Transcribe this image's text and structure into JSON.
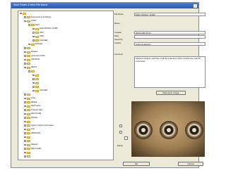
{
  "window": {
    "title": "Save Folder & New File Name"
  },
  "tree": {
    "items": [
      {
        "label": "",
        "depth": 0
      },
      {
        "label": "Documents and Settings",
        "depth": 1
      },
      {
        "label": "Folder",
        "depth": 1
      },
      {
        "label": "0219",
        "depth": 2
      },
      {
        "label": "ELECTRONIC_DUMP",
        "depth": 3
      },
      {
        "label": "0307",
        "depth": 3
      },
      {
        "label": "0329",
        "depth": 3
      },
      {
        "label": "LOGGER",
        "depth": 3
      },
      {
        "label": "Software",
        "depth": 2
      },
      {
        "label": "",
        "depth": 1
      },
      {
        "label": "Melanie",
        "depth": 1
      },
      {
        "label": "parameter Folder",
        "depth": 1
      },
      {
        "label": "INSTRUM",
        "depth": 1
      },
      {
        "label": "",
        "depth": 1
      },
      {
        "label": "MECH",
        "depth": 1
      },
      {
        "label": "",
        "depth": 2
      },
      {
        "label": "",
        "depth": 3
      },
      {
        "label": "",
        "depth": 3
      },
      {
        "label": "",
        "depth": 3
      },
      {
        "label": "",
        "depth": 3
      },
      {
        "label": "LOGGER",
        "depth": 3
      },
      {
        "label": "",
        "depth": 1
      },
      {
        "label": "Lotus",
        "depth": 1
      },
      {
        "label": "MEDIA",
        "depth": 1
      },
      {
        "label": "MSOCache",
        "depth": 1
      },
      {
        "label": "Program Files",
        "depth": 1
      },
      {
        "label": "RECYCLER",
        "depth": 1
      },
      {
        "label": "RTData",
        "depth": 1
      },
      {
        "label": "",
        "depth": 1
      },
      {
        "label": "System Volume Information",
        "depth": 1
      },
      {
        "label": "Test",
        "depth": 1
      },
      {
        "label": "WINDOWS",
        "depth": 1
      },
      {
        "label": "",
        "depth": 1
      },
      {
        "label": "",
        "depth": 1
      },
      {
        "label": "Melanie",
        "depth": 1
      },
      {
        "label": "RECYCLER",
        "depth": 1
      },
      {
        "label": "",
        "depth": 1
      },
      {
        "label": "",
        "depth": 1
      }
    ]
  },
  "form": {
    "file_name_label": "File Name",
    "file_name_value": "ELECTRONIC_DUMP",
    "memo_label": "Memo",
    "created_label": "Created",
    "created_value": "2007/11/05 15:12",
    "data_label": "Data",
    "data_value": "",
    "user_label": "User/Org",
    "user_value": "",
    "creator_label": "Creator",
    "creator_value": "Johns Hopkinson",
    "comment_label": "Comment",
    "comment_value": "Measure location and Size of all the holes and check consistency. total 25 LAN holes",
    "ref_image_button": "Reference Image"
  },
  "side": {
    "delete_label": "Delete"
  },
  "footer": {
    "ok_label": "OK",
    "cancel_label": "Cancel"
  },
  "colors": {
    "titlebar": "#2a5ab5",
    "dialog_bg": "#ece9d8",
    "folder": "#f4d56b",
    "preview_bg": "#6b5a3c"
  }
}
